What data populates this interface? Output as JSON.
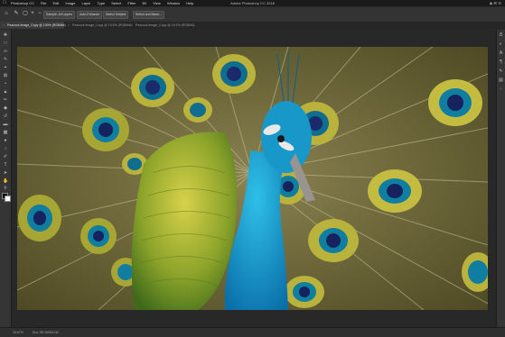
{
  "menubar": {
    "app_menu": "Photoshop CC",
    "menus": [
      "File",
      "Edit",
      "Image",
      "Layer",
      "Type",
      "Select",
      "Filter",
      "3D",
      "View",
      "Window",
      "Help"
    ],
    "window_title": "Adobe Photoshop CC 2018"
  },
  "options_bar": {
    "sample_dropdown": "Sample: All Layers",
    "auto_enhance": "Auto-Enhance",
    "select_subject": "Select Subject",
    "select_mask": "Select and Mask..."
  },
  "tabs": [
    "Peacock Image_Copy @ 100% (RGB/8#)",
    "Peacock Image_Copy @ 16.5% (RGB/8#)",
    "Peacock Image_Copy @ 16.5% (RGB/8#)"
  ],
  "status_bar": {
    "zoom": "16.67%",
    "doc_info": "Doc: 69.1M/69.1M"
  },
  "canvas": {
    "image_subject": "peacock photo"
  },
  "colors": {
    "app_bg": "#282828",
    "panel_bg": "#353535",
    "menubar_bg": "#1a1a1a"
  }
}
